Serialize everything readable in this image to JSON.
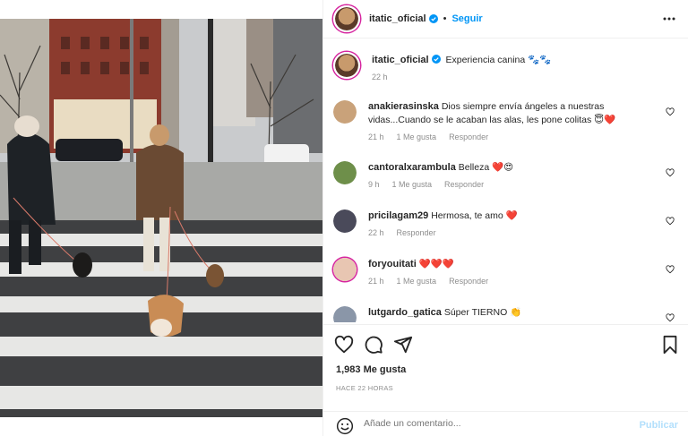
{
  "header": {
    "username": "itatic_oficial",
    "follow_label": "Seguir",
    "separator": "•"
  },
  "caption": {
    "username": "itatic_oficial",
    "text": "Experiencia canina 🐾🐾",
    "time": "22 h"
  },
  "comments": [
    {
      "username": "anakierasinska",
      "text": "Dios siempre envía ángeles a nuestras vidas...Cuando se le acaban las alas, les pone colitas 😇❤️",
      "time": "21 h",
      "likes": "1 Me gusta",
      "reply": "Responder",
      "avatar_color": "#c9a27a"
    },
    {
      "username": "cantoralxarambula",
      "text": "Belleza ❤️😍",
      "time": "9 h",
      "likes": "1 Me gusta",
      "reply": "Responder",
      "avatar_color": "#6e8f4a"
    },
    {
      "username": "pricilagam29",
      "text": "Hermosa, te amo ❤️",
      "time": "22 h",
      "likes": "",
      "reply": "Responder",
      "avatar_color": "#4a4a5a"
    },
    {
      "username": "foryouitati",
      "text": "❤️❤️❤️",
      "time": "21 h",
      "likes": "1 Me gusta",
      "reply": "Responder",
      "avatar_color": "#e8c6b2"
    },
    {
      "username": "lutgardo_gatica",
      "text": "Súper TIERNO 👏",
      "time": "",
      "likes": "",
      "reply": "",
      "avatar_color": "#8a96a8"
    }
  ],
  "stats": {
    "likes": "1,983 Me gusta",
    "posted": "HACE 22 HORAS"
  },
  "composer": {
    "placeholder": "Añade un comentario...",
    "publish_label": "Publicar"
  },
  "colors": {
    "accent": "#0095f6",
    "heart": "#ed4956",
    "muted": "#8e8e8e",
    "publish_disabled": "#b2dffc"
  },
  "icons": {
    "verified": "verified-badge-icon",
    "more": "more-options-icon",
    "like": "heart-icon",
    "comment": "comment-icon",
    "share": "send-icon",
    "save": "bookmark-icon",
    "emoji": "emoji-icon"
  }
}
